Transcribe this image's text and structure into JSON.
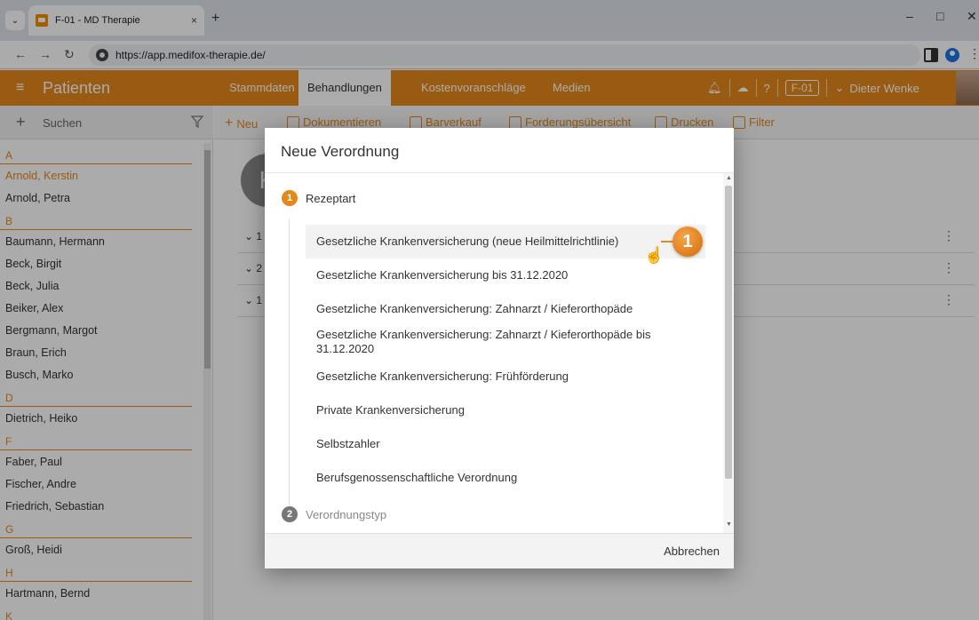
{
  "browser": {
    "tab_title": "F-01 - MD Therapie",
    "tab_close": "×",
    "new_tab": "+",
    "url": "https://app.medifox-therapie.de/",
    "minimize": "–",
    "maximize": "□",
    "close": "✕"
  },
  "header": {
    "app_title": "Patienten",
    "tabs": [
      {
        "label": "Stammdaten"
      },
      {
        "label": "Behandlungen"
      },
      {
        "label": "Kostenvoranschläge"
      },
      {
        "label": "Medien"
      }
    ],
    "workspace_badge": "F-01",
    "user_name": "Dieter Wenke"
  },
  "sidebar": {
    "search_label": "Suchen",
    "patients": [
      {
        "type": "letter",
        "text": "A"
      },
      {
        "type": "patient",
        "text": "Arnold, Kerstin",
        "selected": true
      },
      {
        "type": "patient",
        "text": "Arnold, Petra"
      },
      {
        "type": "letter",
        "text": "B"
      },
      {
        "type": "patient",
        "text": "Baumann, Hermann"
      },
      {
        "type": "patient",
        "text": "Beck, Birgit"
      },
      {
        "type": "patient",
        "text": "Beck, Julia"
      },
      {
        "type": "patient",
        "text": "Beiker, Alex"
      },
      {
        "type": "patient",
        "text": "Bergmann, Margot"
      },
      {
        "type": "patient",
        "text": "Braun, Erich"
      },
      {
        "type": "patient",
        "text": "Busch, Marko"
      },
      {
        "type": "letter",
        "text": "D"
      },
      {
        "type": "patient",
        "text": "Dietrich, Heiko"
      },
      {
        "type": "letter",
        "text": "F"
      },
      {
        "type": "patient",
        "text": "Faber, Paul"
      },
      {
        "type": "patient",
        "text": "Fischer, Andre"
      },
      {
        "type": "patient",
        "text": "Friedrich, Sebastian"
      },
      {
        "type": "letter",
        "text": "G"
      },
      {
        "type": "patient",
        "text": "Groß, Heidi"
      },
      {
        "type": "letter",
        "text": "H"
      },
      {
        "type": "patient",
        "text": "Hartmann, Bernd"
      },
      {
        "type": "letter",
        "text": "K"
      }
    ]
  },
  "actions": {
    "new": "Neu",
    "document": "Dokumentieren",
    "cash_sale": "Barverkauf",
    "claims": "Forderungsübersicht",
    "print": "Drucken",
    "filter": "Filter"
  },
  "main": {
    "avatar_letter": "K",
    "rows": [
      {
        "label": "1"
      },
      {
        "label": "2"
      },
      {
        "label": "1"
      }
    ]
  },
  "dialog": {
    "title": "Neue Verordnung",
    "step1": {
      "number": "1",
      "label": "Rezeptart"
    },
    "step2": {
      "number": "2",
      "label": "Verordnungstyp"
    },
    "options": [
      {
        "label": "Gesetzliche Krankenversicherung (neue Heilmittelrichtlinie)"
      },
      {
        "label": "Gesetzliche Krankenversicherung bis 31.12.2020"
      },
      {
        "label": "Gesetzliche Krankenversicherung: Zahnarzt / Kieferorthopäde"
      },
      {
        "label": "Gesetzliche Krankenversicherung: Zahnarzt / Kieferorthopäde bis 31.12.2020"
      },
      {
        "label": "Gesetzliche Krankenversicherung: Frühförderung"
      },
      {
        "label": "Private Krankenversicherung"
      },
      {
        "label": "Selbstzahler"
      },
      {
        "label": "Berufsgenossenschaftliche Verordnung"
      }
    ],
    "cancel": "Abbrechen"
  },
  "callout": {
    "number": "1"
  },
  "colors": {
    "accent": "#e4881a",
    "header": "#e4881a"
  }
}
